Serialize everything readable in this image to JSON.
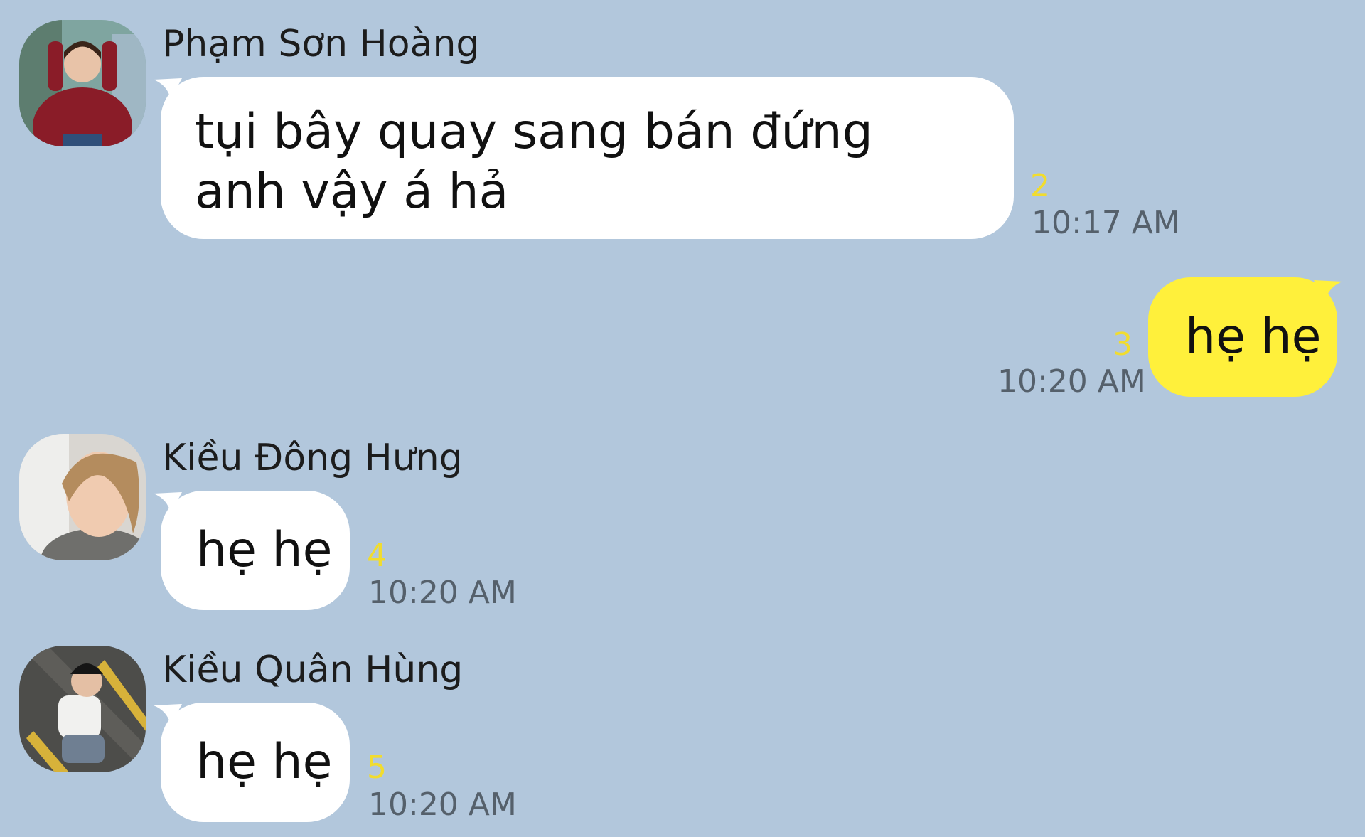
{
  "messages": [
    {
      "sender": "Phạm Sơn Hoàng",
      "avatar_icon": "avatar-photo-red-hoodie",
      "text": "tụi bây quay sang bán đứng anh vậy á hả",
      "unread": "2",
      "time": "10:17 AM",
      "direction": "incoming"
    },
    {
      "text": "hẹ hẹ",
      "unread": "3",
      "time": "10:20 AM",
      "direction": "outgoing"
    },
    {
      "sender": "Kiều Đông Hưng",
      "avatar_icon": "avatar-photo-blonde",
      "text": "hẹ hẹ",
      "unread": "4",
      "time": "10:20 AM",
      "direction": "incoming"
    },
    {
      "sender": "Kiều Quân Hùng",
      "avatar_icon": "avatar-photo-stairs",
      "text": "hẹ hẹ",
      "unread": "5",
      "time": "10:20 AM",
      "direction": "incoming"
    }
  ],
  "colors": {
    "background": "#b2c7dc",
    "incoming_bubble": "#ffffff",
    "outgoing_bubble": "#fff03b",
    "unread_count": "#f1dc2e",
    "timestamp": "#55606b"
  }
}
